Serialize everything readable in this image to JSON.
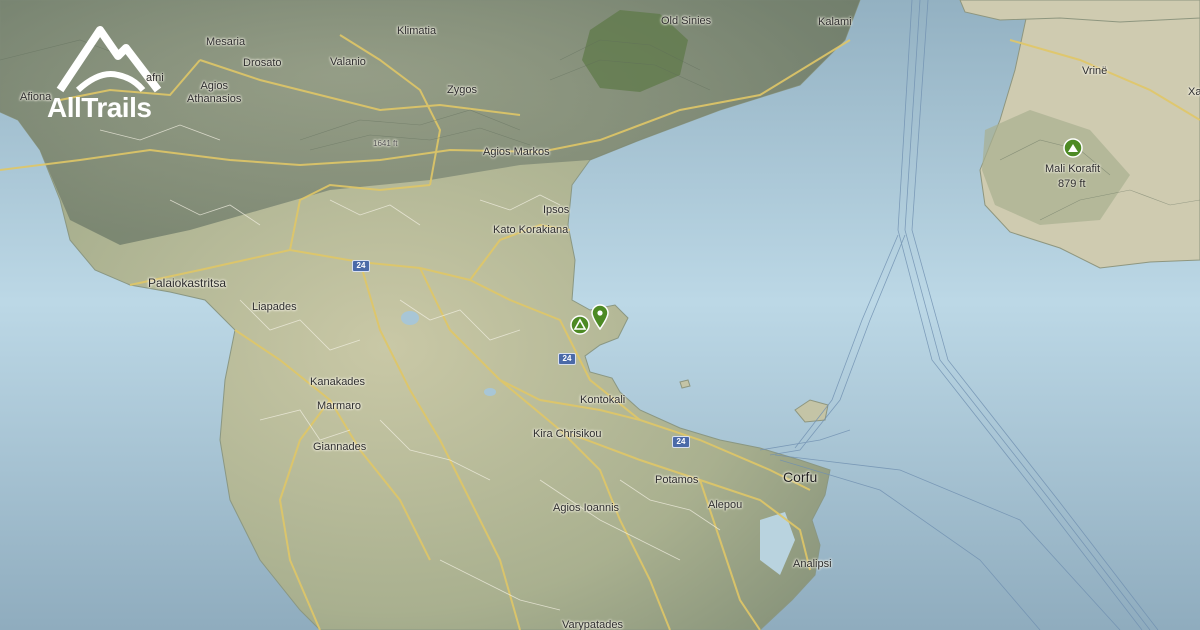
{
  "brand": {
    "name": "AllTrails",
    "logo_icon": "mountain-logo-icon"
  },
  "places": {
    "old_sinies": "Old Sinies",
    "kalami": "Kalami",
    "mesaria": "Mesaria",
    "klimatia": "Klimatia",
    "afni": "afni",
    "drosato": "Drosato",
    "valanio": "Valanio",
    "afiona": "Afiona",
    "agios_athanasios": "Agios\nAthanasios",
    "zygos": "Zygos",
    "agios_markos": "Agios Markos",
    "ipsos": "Ipsos",
    "kato_korakiana": "Kato Korakiana",
    "palaiokastritsa": "Palaiokastritsa",
    "liapades": "Liapades",
    "kanakades": "Kanakades",
    "marmaro": "Marmaro",
    "giannades": "Giannades",
    "kontokali": "Kontokali",
    "kira_chrisikou": "Kira Chrisikou",
    "corfu": "Corfu",
    "potamos": "Potamos",
    "alepou": "Alepou",
    "agios_ioannis": "Agios Ioannis",
    "analipsi": "Analipsi",
    "varypatades": "Varypatades",
    "vrine": "Vrinë",
    "xa": "Xa"
  },
  "peak": {
    "name": "Mali Korafit",
    "elevation": "879 ft",
    "icon": "peak-marker-icon"
  },
  "contour_label": "1641 ft",
  "road_shields": [
    "24",
    "24",
    "24"
  ],
  "markers": [
    {
      "type": "campground",
      "icon": "campground-marker-icon"
    },
    {
      "type": "trailhead",
      "icon": "location-pin-icon"
    }
  ],
  "colors": {
    "sea": "#a9c4d3",
    "land": "#a7ae90",
    "road": "#e0c767",
    "marker_green": "#4d8a24",
    "shield": "#4b6aa8"
  }
}
